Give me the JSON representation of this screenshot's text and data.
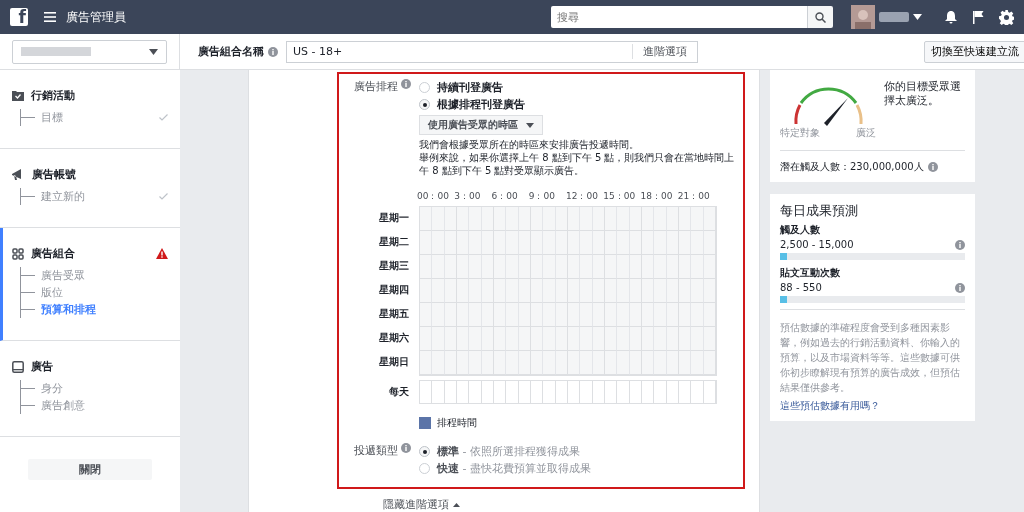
{
  "topbar": {
    "logo": "f",
    "title": "廣告管理員",
    "search": {
      "placeholder": "搜尋"
    }
  },
  "subbar": {
    "name_label": "廣告組合名稱",
    "name_value": "US - 18+",
    "advanced_link": "進階選項",
    "switch_button": "切換至快速建立流"
  },
  "sidebar": {
    "sections": [
      {
        "title": "行銷活動",
        "selected": false,
        "warning": false,
        "complete": true,
        "children": [
          {
            "label": "目標",
            "selected": false
          }
        ]
      },
      {
        "title": "廣告帳號",
        "selected": false,
        "warning": false,
        "complete": true,
        "children": [
          {
            "label": "建立新的",
            "selected": false
          }
        ]
      },
      {
        "title": "廣告組合",
        "selected": true,
        "warning": true,
        "complete": false,
        "children": [
          {
            "label": "廣告受眾",
            "selected": false
          },
          {
            "label": "版位",
            "selected": false
          },
          {
            "label": "預算和排程",
            "selected": true
          }
        ]
      },
      {
        "title": "廣告",
        "selected": false,
        "warning": false,
        "complete": false,
        "children": [
          {
            "label": "身分",
            "selected": false
          },
          {
            "label": "廣告創意",
            "selected": false
          }
        ]
      }
    ],
    "close_button": "關閉"
  },
  "schedule": {
    "label": "廣告排程",
    "options": [
      {
        "label": "持續刊登廣告",
        "selected": false
      },
      {
        "label": "根據排程刊登廣告",
        "selected": true
      }
    ],
    "timezone": "使用廣告受眾的時區",
    "description": [
      "我們會根據受眾所在的時區來安排廣告投遞時間。",
      "舉例來說，如果你選擇上午 8 點到下午 5 點，則我們只會在當地時間上午 8 點到下午 5 點對受眾顯示廣告。"
    ],
    "hours": [
      "00：00",
      "3：00",
      "6：00",
      "9：00",
      "12：00",
      "15：00",
      "18：00",
      "21：00"
    ],
    "days": [
      "星期一",
      "星期二",
      "星期三",
      "星期四",
      "星期五",
      "星期六",
      "星期日"
    ],
    "every_day": "每天",
    "legend": "排程時間"
  },
  "delivery": {
    "label": "投遞類型",
    "options": [
      {
        "label": "**標準** - 依照所選排程獲得成果",
        "selected": true
      },
      {
        "label": "**快速** - 盡快花費預算並取得成果",
        "selected": false
      }
    ]
  },
  "hide_advanced": "隱藏進階選項",
  "audience": {
    "low_label": "特定對象",
    "high_label": "廣泛",
    "message": "你的目標受眾選擇太廣泛。",
    "reach": "潛在觸及人數：230,000,000人"
  },
  "estimates": {
    "title": "每日成果預測",
    "metrics": [
      {
        "label": "觸及人數",
        "value": "2,500 - 15,000",
        "level": 0.04
      },
      {
        "label": "貼文互動次數",
        "value": "88 - 550",
        "level": 0.04
      }
    ],
    "note": "預估數據的準確程度會受到多種因素影響，例如過去的行銷活動資料、你輸入的預算，以及市場資料等等。這些數據可供你初步瞭解現有預算的廣告成效，但預估結果僅供參考。",
    "link": "這些預估數據有用嗎？"
  }
}
